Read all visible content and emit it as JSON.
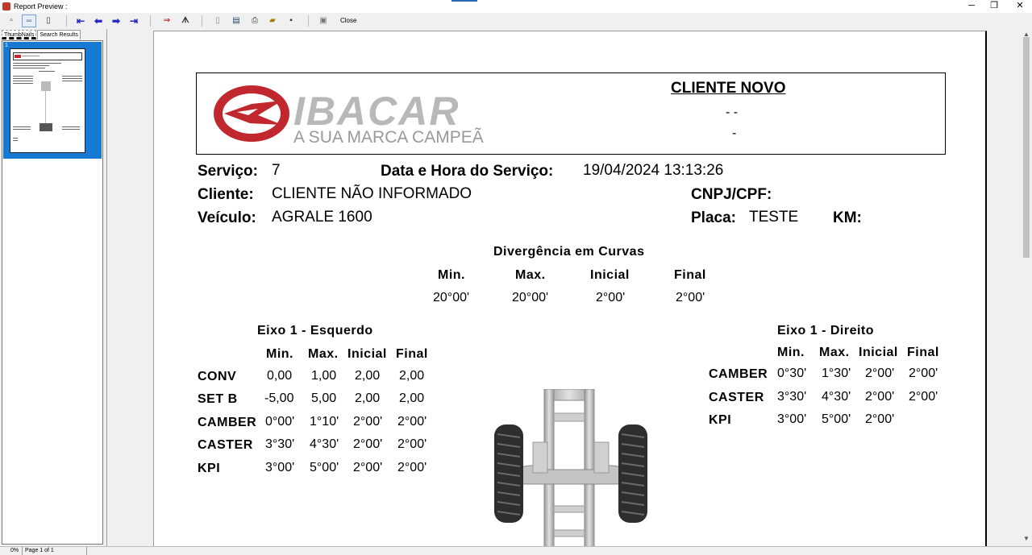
{
  "window": {
    "title": "Report Preview :",
    "minimize": "─",
    "maximize": "❐",
    "close": "✕"
  },
  "toolbar": {
    "close_label": "Close"
  },
  "left_panel": {
    "tabs": [
      "ThumbNails",
      "Search Results"
    ],
    "thumbnail_number": "1"
  },
  "report": {
    "logo_text": "IBACAR",
    "logo_tagline": "A SUA MARCA CAMPEÃ",
    "client_name": "CLIENTE NOVO",
    "client_line2": "- -",
    "client_line3": "-",
    "service_label": "Serviço:",
    "service_value": "7",
    "datetime_label": "Data e Hora do Serviço:",
    "datetime_value": "19/04/2024 13:13:26",
    "client_label": "Cliente:",
    "client_value": "CLIENTE NÃO INFORMADO",
    "doc_label": "CNPJ/CPF:",
    "vehicle_label": "Veículo:",
    "vehicle_value": "AGRALE 1600",
    "plate_label": "Placa:",
    "plate_value": "TESTE",
    "km_label": "KM:",
    "curves": {
      "title": "Divergência em Curvas",
      "headers": [
        "Min.",
        "Max.",
        "Inicial",
        "Final"
      ],
      "values": [
        "20°00'",
        "20°00'",
        "2°00'",
        "2°00'"
      ]
    },
    "left_axle": {
      "title": "Eixo 1 - Esquerdo",
      "headers": [
        "Min.",
        "Max.",
        "Inicial",
        "Final"
      ],
      "rows": [
        {
          "name": "CONV",
          "values": [
            "0,00",
            "1,00",
            "2,00",
            "2,00"
          ]
        },
        {
          "name": "SET B",
          "values": [
            "-5,00",
            "5,00",
            "2,00",
            "2,00"
          ]
        },
        {
          "name": "CAMBER",
          "values": [
            "0°00'",
            "1°10'",
            "2°00'",
            "2°00'"
          ]
        },
        {
          "name": "CASTER",
          "values": [
            "3°30'",
            "4°30'",
            "2°00'",
            "2°00'"
          ]
        },
        {
          "name": "KPI",
          "values": [
            "3°00'",
            "5°00'",
            "2°00'",
            "2°00'"
          ]
        }
      ]
    },
    "right_axle": {
      "title": "Eixo 1 - Direito",
      "headers": [
        "Min.",
        "Max.",
        "Inicial",
        "Final"
      ],
      "rows": [
        {
          "name": "CAMBER",
          "values": [
            "0°30'",
            "1°30'",
            "2°00'",
            "2°00'"
          ]
        },
        {
          "name": "CASTER",
          "values": [
            "3°30'",
            "4°30'",
            "2°00'",
            "2°00'"
          ]
        },
        {
          "name": "KPI",
          "values": [
            "3°00'",
            "5°00'",
            "2°00'",
            ""
          ]
        }
      ]
    }
  },
  "status": {
    "zoom": "0%",
    "page": "Page 1 of 1"
  },
  "colors": {
    "accent": "#1679d4",
    "logo_red": "#c0282d",
    "logo_gray": "#b8b8b8"
  }
}
